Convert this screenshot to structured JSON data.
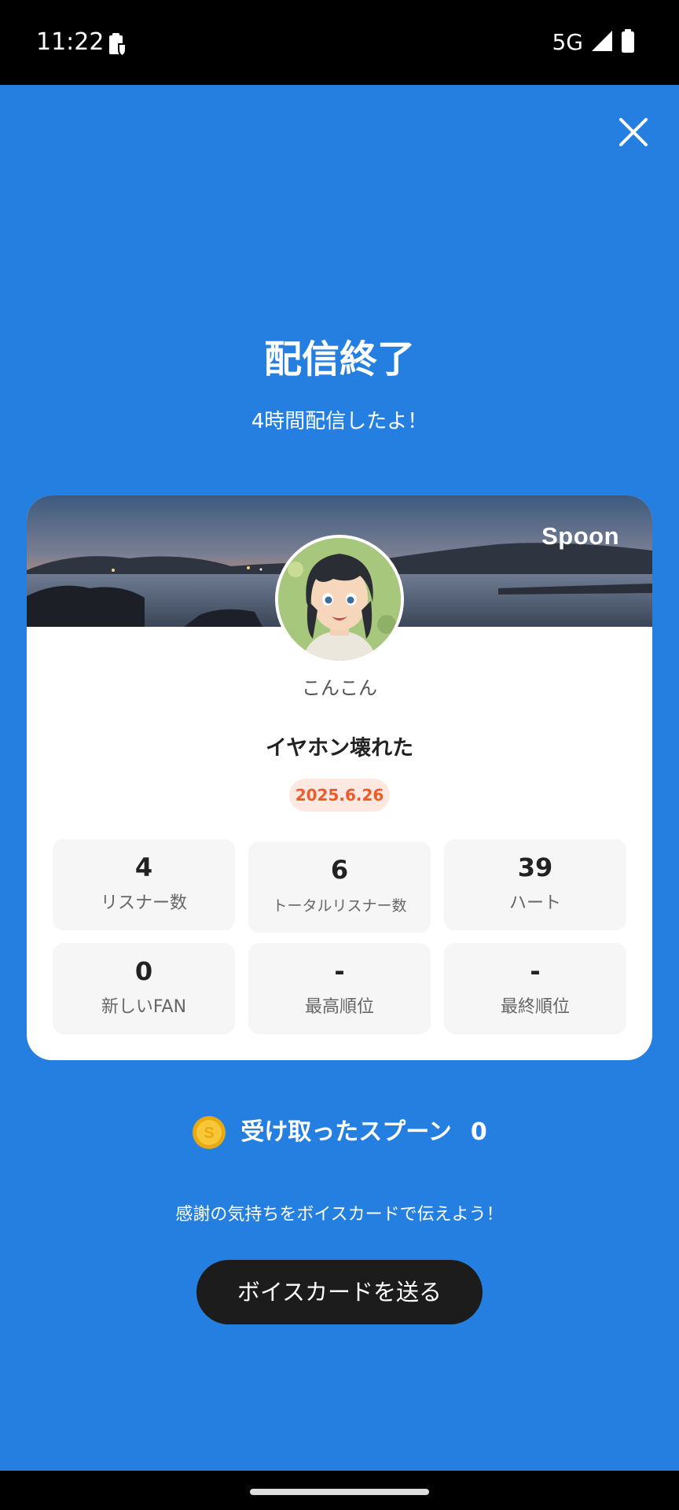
{
  "status_bar": {
    "time": "11:22",
    "network": "5G",
    "icons": [
      "clipboard-lock-icon",
      "signal-icon",
      "battery-icon"
    ]
  },
  "header": {
    "close_icon": "close-icon",
    "title": "配信終了",
    "subtitle": "4時間配信したよ！"
  },
  "card": {
    "brand": "Spoon",
    "username": "こんこん",
    "stream_title": "イヤホン壊れた",
    "date": "2025.6.26",
    "stats": [
      {
        "value": "4",
        "label": "リスナー数"
      },
      {
        "value": "6",
        "label": "トータルリスナー数"
      },
      {
        "value": "39",
        "label": "ハート"
      },
      {
        "value": "0",
        "label": "新しいFAN"
      },
      {
        "value": "-",
        "label": "最高順位"
      },
      {
        "value": "-",
        "label": "最終順位"
      }
    ]
  },
  "spoons": {
    "icon": "spoon-coin-icon",
    "label": "受け取ったスプーン",
    "count": "0"
  },
  "hint": "感謝の気持ちをボイスカードで伝えよう！",
  "voice_card_button": "ボイスカードを送る",
  "colors": {
    "background": "#247fe1",
    "card": "#ffffff",
    "date_text": "#ef5a2a",
    "date_bg": "#fde8e2",
    "button": "#1c1c1c",
    "coin": "#f2b71f"
  }
}
